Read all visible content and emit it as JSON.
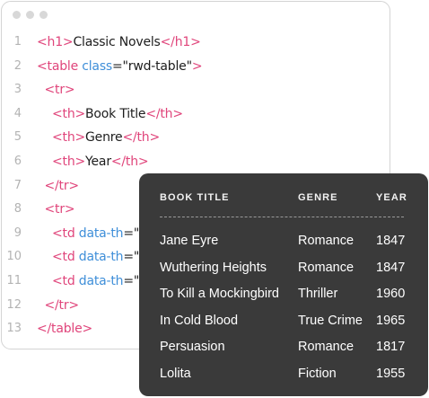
{
  "editor": {
    "lines": [
      {
        "n": "1",
        "parts": [
          {
            "t": "<h1>",
            "c": "tag"
          },
          {
            "t": "Classic Novels",
            "c": "text"
          },
          {
            "t": "</h1>",
            "c": "tag"
          }
        ]
      },
      {
        "n": "2",
        "parts": [
          {
            "t": "<table ",
            "c": "tag"
          },
          {
            "t": "class",
            "c": "attr"
          },
          {
            "t": "=\"rwd-table\"",
            "c": "text"
          },
          {
            "t": ">",
            "c": "tag"
          }
        ]
      },
      {
        "n": "3",
        "parts": [
          {
            "t": "  <tr>",
            "c": "tag"
          }
        ]
      },
      {
        "n": "4",
        "parts": [
          {
            "t": "    <th>",
            "c": "tag"
          },
          {
            "t": "Book Title",
            "c": "text"
          },
          {
            "t": "</th>",
            "c": "tag"
          }
        ]
      },
      {
        "n": "5",
        "parts": [
          {
            "t": "    <th>",
            "c": "tag"
          },
          {
            "t": "Genre",
            "c": "text"
          },
          {
            "t": "</th>",
            "c": "tag"
          }
        ]
      },
      {
        "n": "6",
        "parts": [
          {
            "t": "    <th>",
            "c": "tag"
          },
          {
            "t": "Year",
            "c": "text"
          },
          {
            "t": "</th>",
            "c": "tag"
          }
        ]
      },
      {
        "n": "7",
        "parts": [
          {
            "t": "  </tr>",
            "c": "tag"
          }
        ]
      },
      {
        "n": "8",
        "parts": [
          {
            "t": "  <tr>",
            "c": "tag"
          }
        ]
      },
      {
        "n": "9",
        "parts": [
          {
            "t": "    <td ",
            "c": "tag"
          },
          {
            "t": "data-th",
            "c": "attr"
          },
          {
            "t": "=\"B",
            "c": "text"
          }
        ]
      },
      {
        "n": "10",
        "parts": [
          {
            "t": "    <td ",
            "c": "tag"
          },
          {
            "t": "data-th",
            "c": "attr"
          },
          {
            "t": "=\"G",
            "c": "text"
          }
        ]
      },
      {
        "n": "11",
        "parts": [
          {
            "t": "    <td ",
            "c": "tag"
          },
          {
            "t": "data-th",
            "c": "attr"
          },
          {
            "t": "=\"Y",
            "c": "text"
          }
        ]
      },
      {
        "n": "12",
        "parts": [
          {
            "t": "  </tr>",
            "c": "tag"
          }
        ]
      },
      {
        "n": "13",
        "parts": [
          {
            "t": "</table>",
            "c": "tag"
          }
        ]
      }
    ]
  },
  "table": {
    "headers": {
      "title": "BOOK TITLE",
      "genre": "GENRE",
      "year": "YEAR"
    },
    "rows": [
      {
        "title": "Jane Eyre",
        "genre": "Romance",
        "year": "1847"
      },
      {
        "title": "Wuthering Heights",
        "genre": "Romance",
        "year": "1847"
      },
      {
        "title": "To Kill a Mockingbird",
        "genre": "Thriller",
        "year": "1960"
      },
      {
        "title": "In Cold Blood",
        "genre": "True Crime",
        "year": "1965"
      },
      {
        "title": "Persuasion",
        "genre": "Romance",
        "year": "1817"
      },
      {
        "title": "Lolita",
        "genre": "Fiction",
        "year": "1955"
      }
    ]
  },
  "colors": {
    "tag": "#e0457b",
    "attr": "#3f8fd9",
    "text": "#1d1d1d",
    "panel_bg": "#3a3a3a"
  }
}
